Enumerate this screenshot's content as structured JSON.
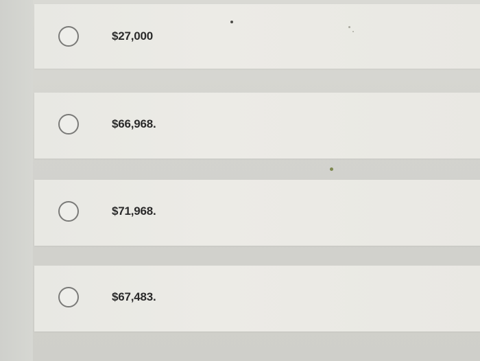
{
  "answer_options": [
    {
      "label": "$27,000"
    },
    {
      "label": "$66,968."
    },
    {
      "label": "$71,968."
    },
    {
      "label": "$67,483."
    }
  ],
  "colors": {
    "background": "#d5d5d0",
    "card": "#eaeae5",
    "radio_border": "#7a7a78",
    "text": "#2a2a2a"
  }
}
